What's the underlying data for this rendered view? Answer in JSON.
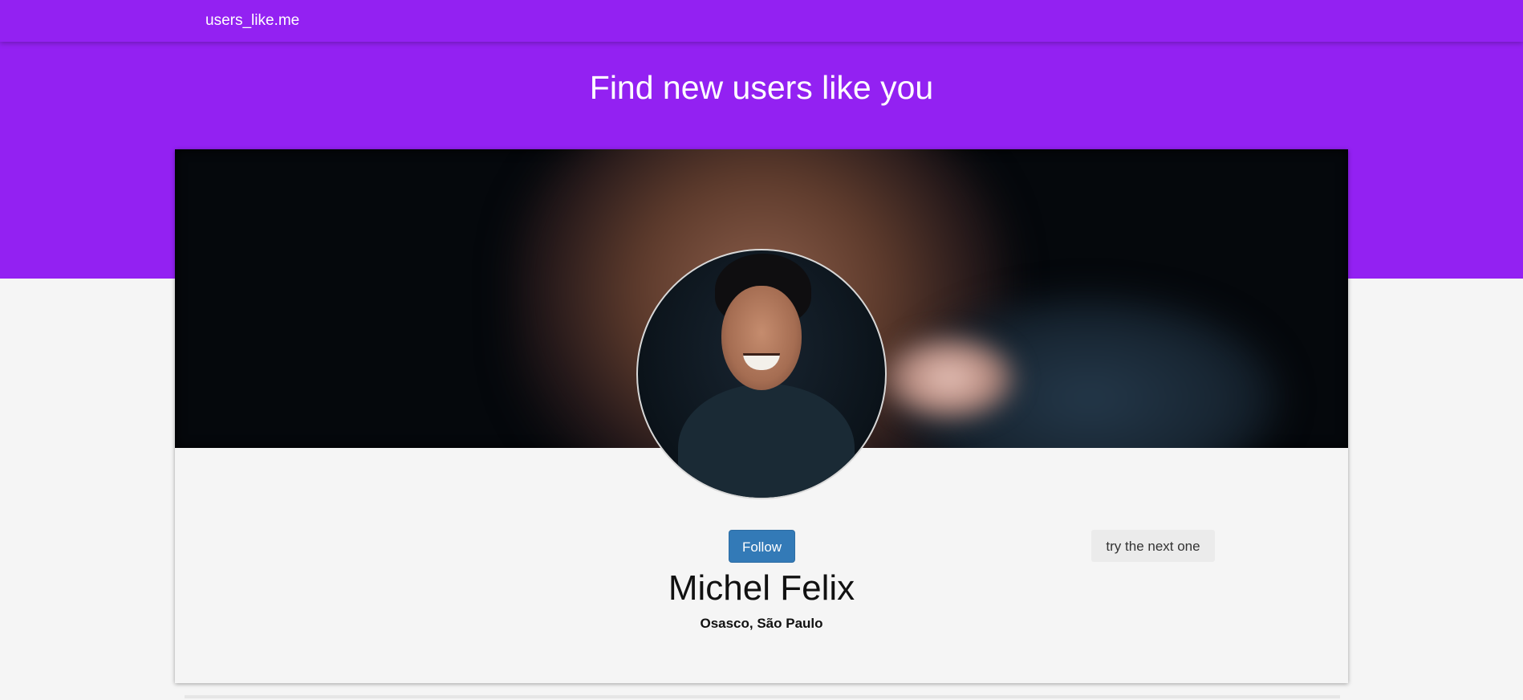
{
  "navbar": {
    "brand": "users_like.me"
  },
  "hero": {
    "title": "Find new users like you"
  },
  "profile": {
    "name": "Michel Felix",
    "location": "Osasco, São Paulo",
    "follow_label": "Follow",
    "next_label": "try the next one"
  },
  "colors": {
    "brand_purple": "#9321f2",
    "primary_button": "#337ab7",
    "page_background": "#f5f5f5"
  }
}
